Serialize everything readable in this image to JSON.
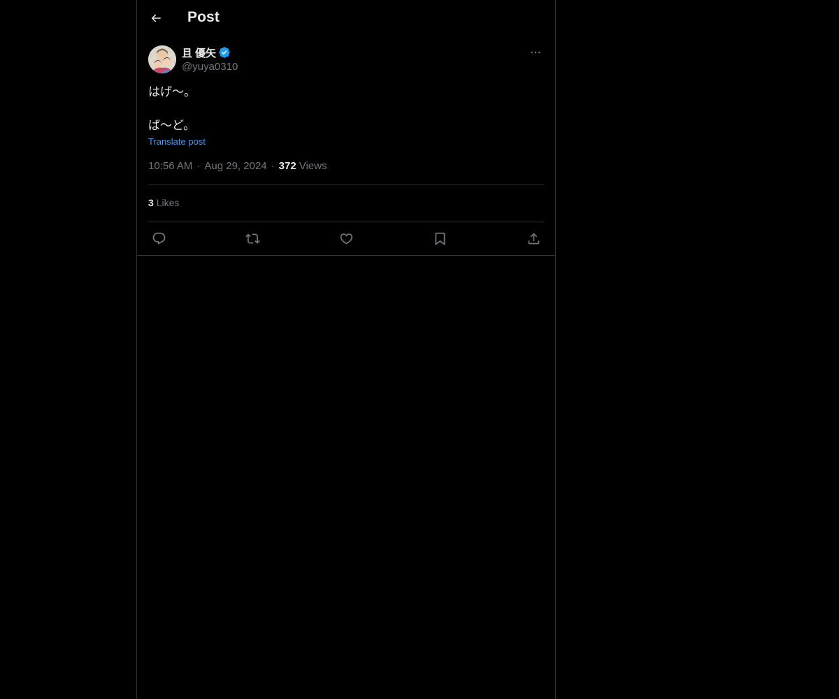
{
  "header": {
    "title": "Post",
    "back_icon": "arrow-left-icon"
  },
  "post": {
    "author": {
      "display_name": "且 優矢",
      "handle": "@yuya0310",
      "verified": true,
      "verified_color": "#1d9bf0"
    },
    "text": "はげ〜。\n\nば〜ど。",
    "translate_label": "Translate post",
    "time": "10:56 AM",
    "date": "Aug 29, 2024",
    "separator": "·",
    "views_count": "372",
    "views_label": "Views",
    "likes_count": "3",
    "likes_label": "Likes"
  },
  "actions": [
    {
      "name": "reply",
      "icon": "reply-icon"
    },
    {
      "name": "repost",
      "icon": "repost-icon"
    },
    {
      "name": "like",
      "icon": "heart-icon"
    },
    {
      "name": "bookmark",
      "icon": "bookmark-icon"
    },
    {
      "name": "share",
      "icon": "share-icon"
    }
  ],
  "colors": {
    "background": "#000000",
    "text": "#e7e9ea",
    "secondary_text": "#71767b",
    "border": "#2f3336",
    "link": "#4a99e9"
  }
}
